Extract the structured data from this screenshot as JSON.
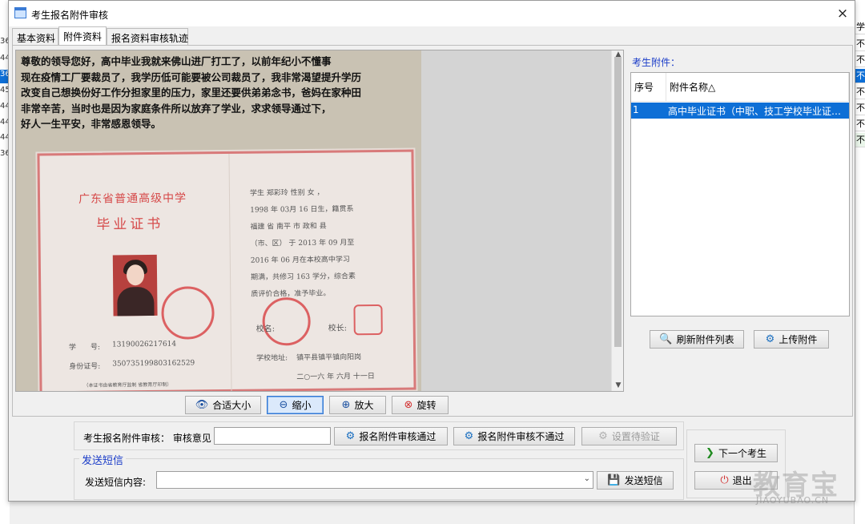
{
  "window": {
    "title": "考生报名附件审核",
    "close_glyph": "×"
  },
  "tabs": [
    {
      "label": "基本资料"
    },
    {
      "label": "附件资料"
    },
    {
      "label": "报名资料审核轨迹"
    }
  ],
  "background_left_rows": [
    "36",
    "44",
    "36",
    "45",
    "44",
    "44",
    "44",
    "36"
  ],
  "background_right_header": "学",
  "background_right_cells": [
    "不",
    "不",
    "不",
    "不",
    "不",
    "不",
    "不"
  ],
  "photo": {
    "message_lines": [
      "尊敬的领导您好，高中毕业我就来佛山进厂打工了，以前年纪小不懂事",
      "现在疫情工厂要裁员了，我学历低可能要被公司裁员了，我非常渴望提升学历",
      "改变自己想换份好工作分担家里的压力，家里还要供弟弟念书，爸妈在家种田",
      "非常辛苦，当时也是因为家庭条件所以放弃了学业，求求领导通过下，",
      "好人一生平安，非常感恩领导。"
    ],
    "certificate": {
      "school_heading": "广东省普通高级中学",
      "cert_heading": "毕业证书",
      "student_no_label": "学　　号:",
      "student_no": "13190026217614",
      "id_label": "身份证号:",
      "id_value": "350735199803162529",
      "footnote": "（本证书由省教育厅监制  省教育厅印制）",
      "right_lines": [
        "学生  郑彩玲         性别  女  ，",
        "1998  年  03月   16 日生，籍贯系",
        "福建     省   南平    市  政和    县",
        "（市、区）  于    2013  年  09 月至",
        "2016   年   06  月在本校高中学习",
        "期满，共修习    163   学分，综合素",
        "质评价合格，准予毕业。"
      ],
      "school_label": "校名:",
      "principal_label": "校长:",
      "address_label": "学校地址:",
      "address_value": "镇平县镇平镇向阳岗",
      "date": "二○一六 年   六月   十一日"
    }
  },
  "viewer_buttons": {
    "fit": "合适大小",
    "zoom_out": "缩小",
    "zoom_in": "放大",
    "rotate": "旋转"
  },
  "attachments": {
    "label": "考生附件：",
    "columns": [
      "序号",
      "附件名称△"
    ],
    "rows": [
      {
        "no": "1",
        "name": "高中毕业证书（中职、技工学校毕业证书..."
      }
    ],
    "refresh_button": "刷新附件列表",
    "upload_button": "上传附件"
  },
  "review": {
    "label": "考生报名附件审核：",
    "opinion_label": "审核意见",
    "opinion_value": "",
    "approve_button": "报名附件审核通过",
    "reject_button": "报名附件审核不通过",
    "pending_button": "设置待验证"
  },
  "sms": {
    "legend": "发送短信",
    "content_label": "发送短信内容:",
    "content_value": "",
    "send_button": "发送短信"
  },
  "nav": {
    "next_button": "下一个考生",
    "exit_button": "退出"
  },
  "watermark": {
    "main": "教育宝",
    "sub": "JIAOYUBAO.CN"
  },
  "colors": {
    "selection": "#0e6fd6",
    "link_blue": "#1a3cc8",
    "seal_red": "#d8494b"
  }
}
